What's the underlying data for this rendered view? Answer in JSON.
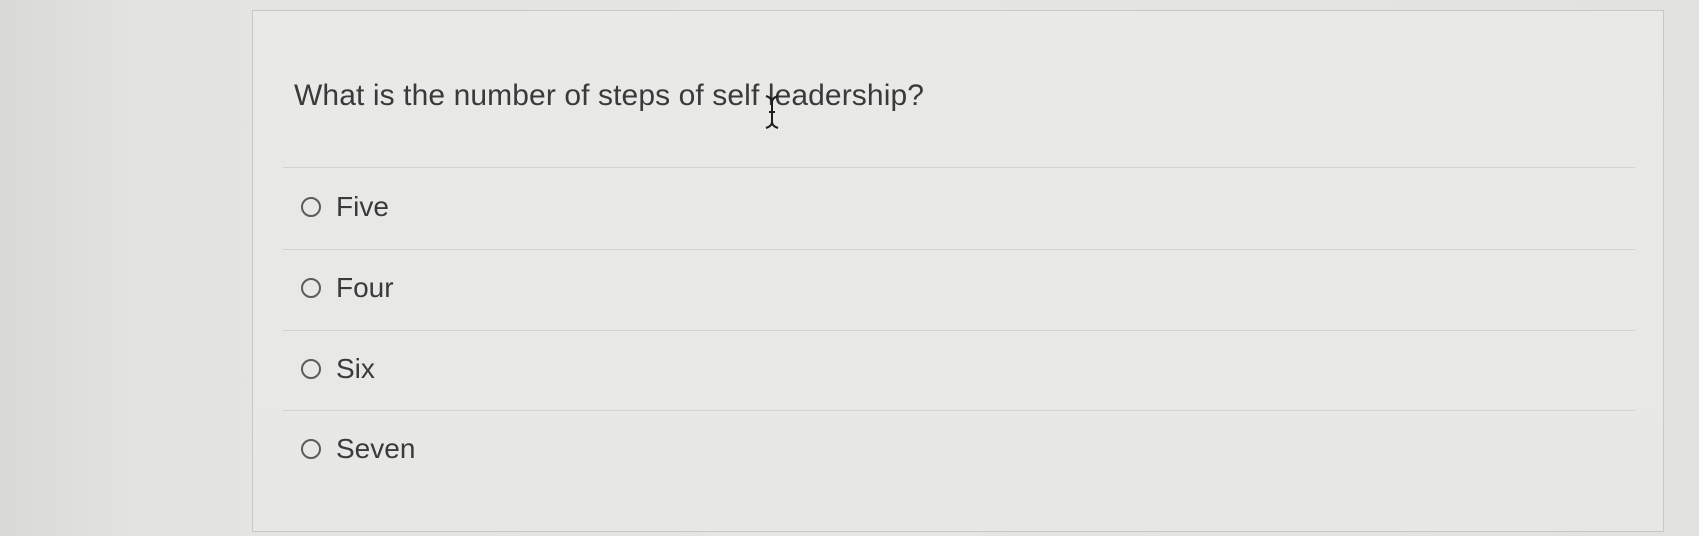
{
  "question": {
    "text": "What is the number of steps of self leadership?"
  },
  "options": [
    {
      "label": "Five",
      "selected": false
    },
    {
      "label": "Four",
      "selected": false
    },
    {
      "label": "Six",
      "selected": false
    },
    {
      "label": "Seven",
      "selected": false
    }
  ],
  "icons": {
    "cursor": "text-cursor-icon",
    "radio": "radio-button-icon"
  }
}
